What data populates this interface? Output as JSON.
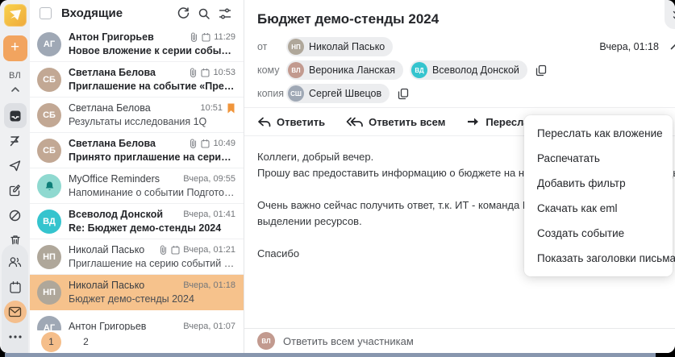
{
  "colors": {
    "accent_orange": "#F2A45F",
    "selected_row": "#F6C28C",
    "active_circle": "#F5BE8A",
    "teal_avatar": "#35C4CE",
    "flag_orange": "#F0953B"
  },
  "rail": {
    "compose_label": "+",
    "profile_initials": "ВЛ",
    "items": [
      "inbox",
      "flagged",
      "sent",
      "drafts",
      "spam",
      "trash"
    ],
    "bottom_items": [
      "contacts",
      "calendar",
      "mail",
      "more"
    ]
  },
  "list": {
    "title": "Входящие",
    "emails": [
      {
        "sender": "Антон Григорьев",
        "subject": "Новое вложение к серии событий «Аналити...",
        "time": "11:29",
        "avatar": {
          "text": "АГ",
          "bg": "#9FA8B5"
        }
      },
      {
        "sender": "Светлана Белова",
        "subject": "Приглашение на событие «Предварительно...",
        "time": "10:53",
        "avatar": {
          "text": "СБ",
          "bg": "#C2A894"
        }
      },
      {
        "sender": "Светлана Белова",
        "subject": "Результаты исследования 1Q",
        "time": "10:51",
        "avatar": {
          "text": "СБ",
          "bg": "#C2A894"
        }
      },
      {
        "sender": "Светлана Белова",
        "subject": "Принято приглашение на серию событий «...",
        "time": "10:49",
        "avatar": {
          "text": "СБ",
          "bg": "#C2A894"
        }
      },
      {
        "sender": "MyOffice Reminders",
        "subject": "Напоминание о событии Подготовить отчет...",
        "time": "Вчера, 09:55",
        "avatar": {
          "text": "",
          "bg": "#8FD9D0"
        }
      },
      {
        "sender": "Всеволод Донской",
        "subject": "Re: Бюджет демо-стенды 2024",
        "time": "Вчера, 01:41",
        "avatar": {
          "text": "ВД",
          "bg": "#35C4CE"
        }
      },
      {
        "sender": "Николай Пасько",
        "subject": "Приглашение на серию событий «Демо стен...",
        "time": "Вчера, 01:21",
        "avatar": {
          "text": "НП",
          "bg": "#AFA79A"
        }
      },
      {
        "sender": "Николай Пасько",
        "subject": "Бюджет демо-стенды 2024",
        "time": "Вчера, 01:18",
        "avatar": {
          "text": "НП",
          "bg": "#AFA79A"
        }
      },
      {
        "sender": "Антон Григорьев",
        "subject": "",
        "time": "Вчера, 01:07",
        "avatar": {
          "text": "АГ",
          "bg": "#9FA8B5"
        }
      }
    ],
    "pagination": {
      "pages": [
        "1",
        "2"
      ],
      "active_index": 0
    }
  },
  "message": {
    "subject": "Бюджет демо-стенды 2024",
    "from_label": "от",
    "from_chip": {
      "name": "Николай Пасько",
      "initials": "НП",
      "bg": "#AFA79A"
    },
    "to_label": "кому",
    "to_chips": [
      {
        "name": "Вероника Ланская",
        "initials": "ВЛ",
        "bg": "#C29A8F"
      },
      {
        "name": "Всеволод Донской",
        "initials": "ВД",
        "bg": "#35C4CE"
      }
    ],
    "cc_label": "копия",
    "cc_chips": [
      {
        "name": "Сергей Швецов",
        "initials": "СШ",
        "bg": "#9FA8B5"
      }
    ],
    "date": "Вчера, 01:18",
    "toolbar": {
      "reply": "Ответить",
      "reply_all": "Ответить всем",
      "forward": "Переслать"
    },
    "body_lines": [
      "Коллеги, добрый вечер.",
      "Прошу вас предоставить информацию о бюджете на наши демонстрационные стенды",
      "",
      "Очень важно сейчас получить ответ, т.к. ИТ - команда Всеволода, уже ждет решения о",
      "выделении ресурсов.",
      "",
      "Спасибо"
    ],
    "reply_bar": {
      "placeholder": "Ответить всем участникам",
      "user_initials": "ВЛ",
      "bg": "#C29A8F"
    }
  },
  "menu": {
    "items": [
      "Переслать как вложение",
      "Распечатать",
      "Добавить фильтр",
      "Скачать как eml",
      "Создать событие",
      "Показать заголовки письма"
    ]
  }
}
